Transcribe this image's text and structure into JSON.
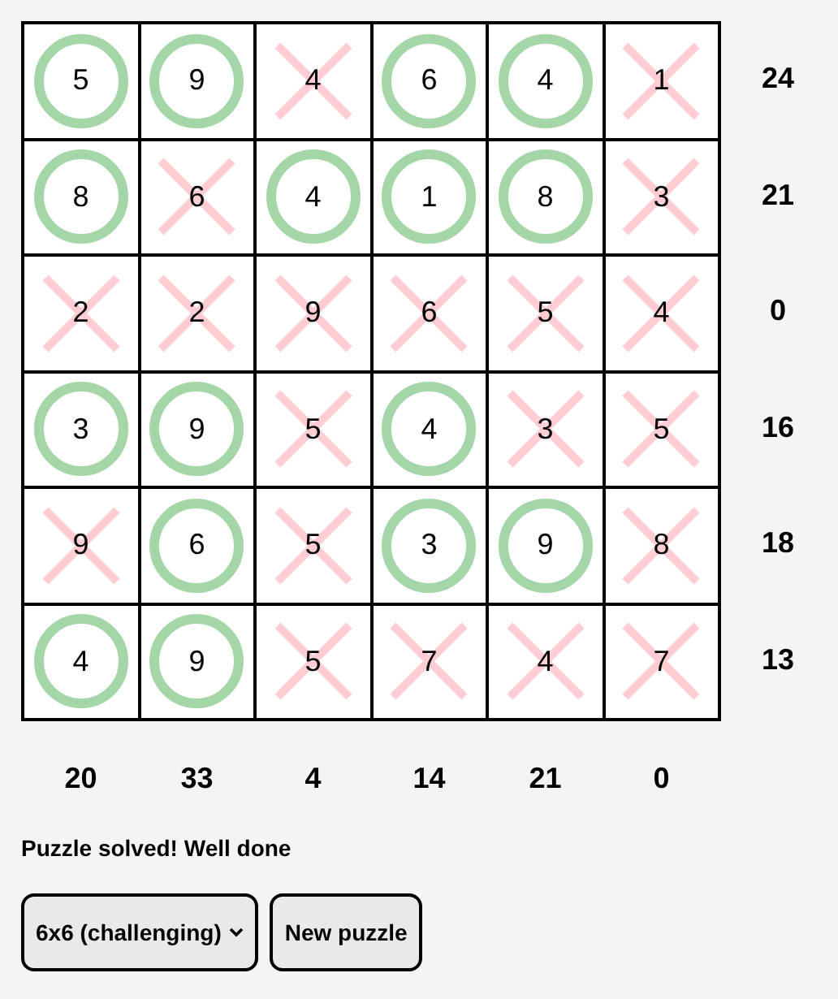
{
  "grid": {
    "rows": [
      {
        "cells": [
          {
            "value": "5",
            "kind": "circled"
          },
          {
            "value": "9",
            "kind": "circled"
          },
          {
            "value": "4",
            "kind": "crossed"
          },
          {
            "value": "6",
            "kind": "circled"
          },
          {
            "value": "4",
            "kind": "circled"
          },
          {
            "value": "1",
            "kind": "crossed"
          }
        ],
        "sum": "24"
      },
      {
        "cells": [
          {
            "value": "8",
            "kind": "circled"
          },
          {
            "value": "6",
            "kind": "crossed"
          },
          {
            "value": "4",
            "kind": "circled"
          },
          {
            "value": "1",
            "kind": "circled"
          },
          {
            "value": "8",
            "kind": "circled"
          },
          {
            "value": "3",
            "kind": "crossed"
          }
        ],
        "sum": "21"
      },
      {
        "cells": [
          {
            "value": "2",
            "kind": "crossed"
          },
          {
            "value": "2",
            "kind": "crossed"
          },
          {
            "value": "9",
            "kind": "crossed"
          },
          {
            "value": "6",
            "kind": "crossed"
          },
          {
            "value": "5",
            "kind": "crossed"
          },
          {
            "value": "4",
            "kind": "crossed"
          }
        ],
        "sum": "0"
      },
      {
        "cells": [
          {
            "value": "3",
            "kind": "circled"
          },
          {
            "value": "9",
            "kind": "circled"
          },
          {
            "value": "5",
            "kind": "crossed"
          },
          {
            "value": "4",
            "kind": "circled"
          },
          {
            "value": "3",
            "kind": "crossed"
          },
          {
            "value": "5",
            "kind": "crossed"
          }
        ],
        "sum": "16"
      },
      {
        "cells": [
          {
            "value": "9",
            "kind": "crossed"
          },
          {
            "value": "6",
            "kind": "circled"
          },
          {
            "value": "5",
            "kind": "crossed"
          },
          {
            "value": "3",
            "kind": "circled"
          },
          {
            "value": "9",
            "kind": "circled"
          },
          {
            "value": "8",
            "kind": "crossed"
          }
        ],
        "sum": "18"
      },
      {
        "cells": [
          {
            "value": "4",
            "kind": "circled"
          },
          {
            "value": "9",
            "kind": "circled"
          },
          {
            "value": "5",
            "kind": "crossed"
          },
          {
            "value": "7",
            "kind": "crossed"
          },
          {
            "value": "4",
            "kind": "crossed"
          },
          {
            "value": "7",
            "kind": "crossed"
          }
        ],
        "sum": "13"
      }
    ],
    "column_sums": [
      "20",
      "33",
      "4",
      "14",
      "21",
      "0"
    ]
  },
  "status": "Puzzle solved! Well done",
  "size_select": {
    "value": "6x6 (challenging)"
  },
  "buttons": [
    "New puzzle"
  ]
}
